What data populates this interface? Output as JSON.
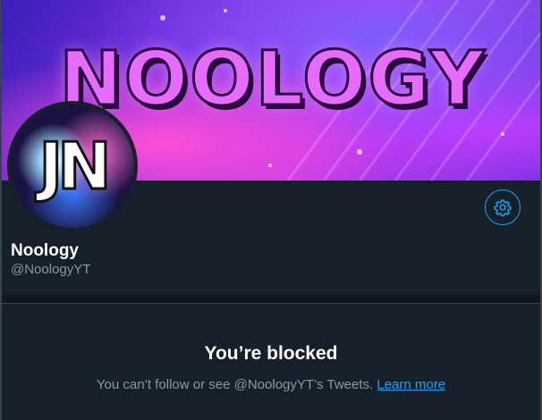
{
  "banner": {
    "title": "NOOLOGY"
  },
  "avatar": {
    "letters": "JN"
  },
  "profile": {
    "display_name": "Noology",
    "handle": "@NoologyYT",
    "settings_icon": "gear-icon"
  },
  "blocked": {
    "title": "You’re blocked",
    "message": "You can’t follow or see @NoologyYT’s Tweets.",
    "link_label": "Learn more"
  },
  "colors": {
    "background": "#15202b",
    "accent": "#1da1f2",
    "secondary_text": "#8899a6"
  }
}
